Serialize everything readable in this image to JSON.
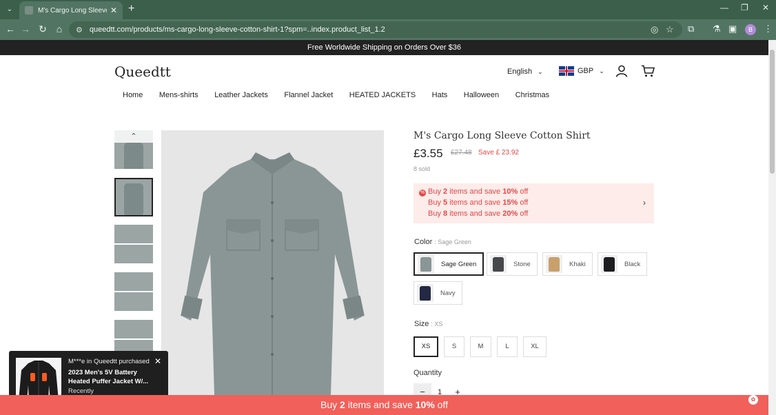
{
  "browser": {
    "tab_title": "M's Cargo Long Sleeve Cotton",
    "url": "queedtt.com/products/ms-cargo-long-sleeve-cotton-shirt-1?spm=..index.product_list_1.2",
    "profile_initial": "B",
    "theme_color": "#3c5f4c"
  },
  "announcement": "Free Worldwide Shipping on Orders Over $36",
  "header": {
    "logo": "Queedtt",
    "language": "English",
    "currency": "GBP"
  },
  "nav": [
    "Home",
    "Mens-shirts",
    "Leather Jackets",
    "Flannel Jacket",
    "HEATED JACKETS",
    "Hats",
    "Halloween",
    "Christmas"
  ],
  "product": {
    "title": "M's Cargo Long Sleeve Cotton Shirt",
    "price": "£3.55",
    "old_price": "£27.48",
    "save": "Save £ 23.92",
    "sold": "8 sold",
    "shirt_color": "#8a9696"
  },
  "promo": {
    "lines": [
      {
        "pre": "Buy ",
        "qty": "2",
        "mid": " items and save ",
        "pct": "10%",
        "post": " off"
      },
      {
        "pre": "Buy ",
        "qty": "5",
        "mid": " items and save ",
        "pct": "15%",
        "post": " off"
      },
      {
        "pre": "Buy ",
        "qty": "8",
        "mid": " items and save ",
        "pct": "20%",
        "post": " off"
      }
    ],
    "accent": "#e34747"
  },
  "color_option": {
    "label": "Color",
    "selected": ": Sage Green",
    "swatches": [
      {
        "name": "Sage Green",
        "hex": "#8a9696"
      },
      {
        "name": "Stone",
        "hex": "#45484a"
      },
      {
        "name": "Khaki",
        "hex": "#c9a06c"
      },
      {
        "name": "Black",
        "hex": "#1d1d1f"
      },
      {
        "name": "Navy",
        "hex": "#232844"
      }
    ]
  },
  "size_option": {
    "label": "Size",
    "selected": ": XS",
    "sizes": [
      "XS",
      "S",
      "M",
      "L",
      "XL"
    ]
  },
  "quantity": {
    "label": "Quantity",
    "value": "1"
  },
  "popup": {
    "who": "M***e in Queedtt purchased",
    "product": "2023 Men's 5V Battery Heated Puffer Jacket W/...",
    "when": "Recently"
  },
  "bottom_bar": {
    "pre": "Buy ",
    "qty": "2",
    "mid": " items and save ",
    "pct": "10%",
    "post": " off"
  }
}
